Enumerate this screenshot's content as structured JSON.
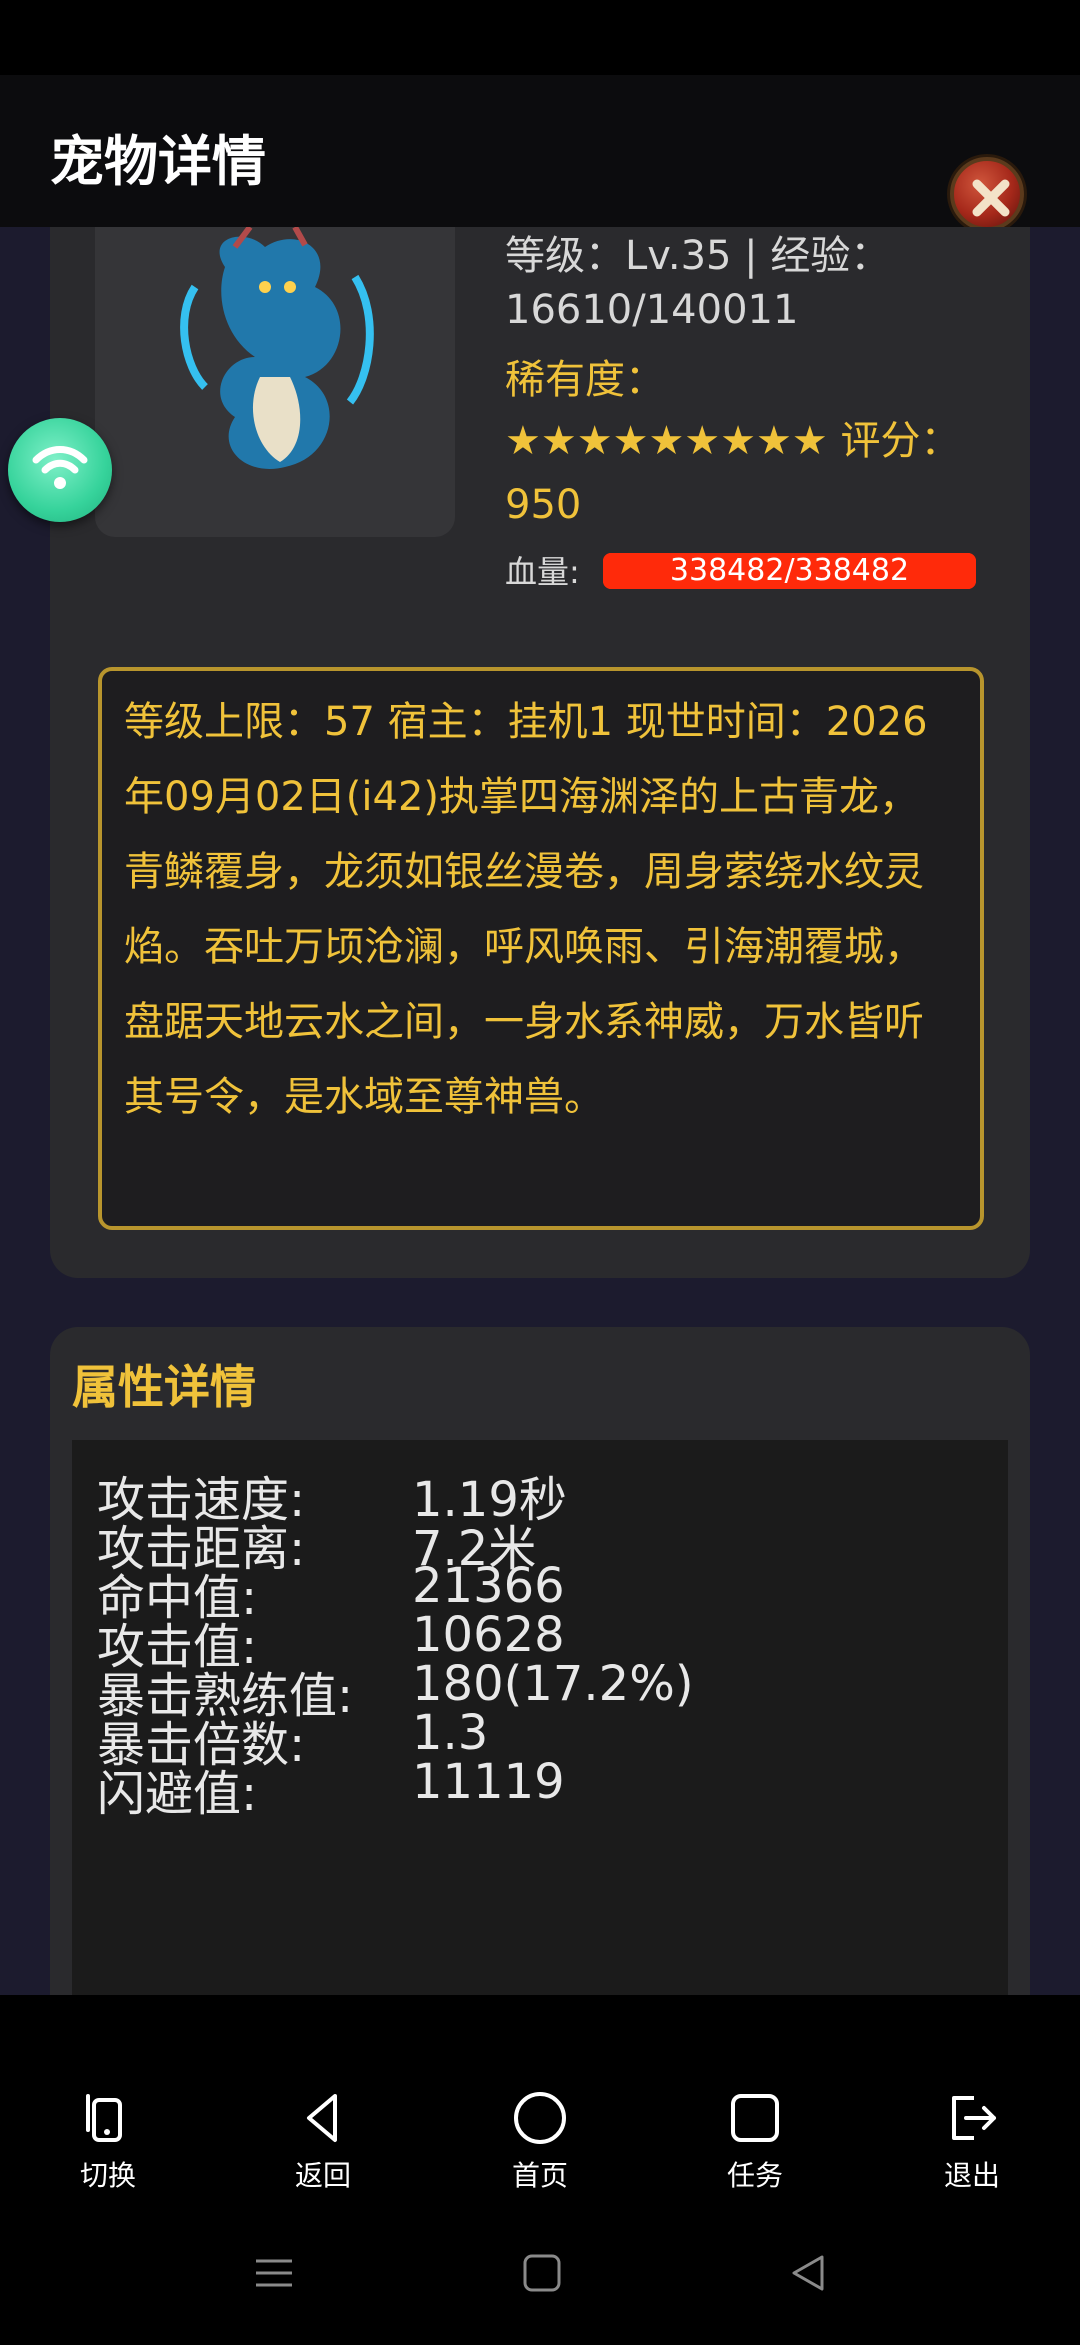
{
  "header": {
    "title": "宠物详情"
  },
  "pet": {
    "level_line": "等级：Lv.35 | 经验：16610/140011",
    "rarity_label": "稀有度：",
    "stars_line": "★★★★★★★★★ 评分：950",
    "hp_label": "血量:",
    "hp_text": "338482/338482",
    "hp_fraction": 1.0,
    "description": "等级上限：57 宿主：挂机1 现世时间：2026年09月02日(i42)执掌四海渊泽的上古青龙，青鳞覆身，龙须如银丝漫卷，周身萦绕水纹灵焰。吞吐万顷沧澜，呼风唤雨、引海潮覆城，盘踞天地云水之间，一身水系神威，万水皆听其号令，是水域至尊神兽。"
  },
  "attributes": {
    "title": "属性详情",
    "rows": [
      {
        "key": "攻击速度:",
        "value": "1.19秒"
      },
      {
        "key": "攻击距离:",
        "value": "7.2米"
      },
      {
        "key": "命中值:",
        "value": "21366"
      },
      {
        "key": "攻击值:",
        "value": "10628"
      },
      {
        "key": "暴击熟练值:",
        "value": "180(17.2%)"
      },
      {
        "key": "暴击倍数:",
        "value": "1.3"
      },
      {
        "key": "闪避值:",
        "value": "11119"
      }
    ]
  },
  "nav": [
    {
      "label": "切换",
      "icon": "phone-switch-icon"
    },
    {
      "label": "返回",
      "icon": "back-triangle-icon"
    },
    {
      "label": "首页",
      "icon": "home-circle-icon"
    },
    {
      "label": "任务",
      "icon": "task-square-icon"
    },
    {
      "label": "退出",
      "icon": "exit-icon"
    }
  ],
  "colors": {
    "accent_gold": "#f0c23a",
    "hp_red": "#ff2a0a",
    "wifi_green": "#36d39b"
  }
}
